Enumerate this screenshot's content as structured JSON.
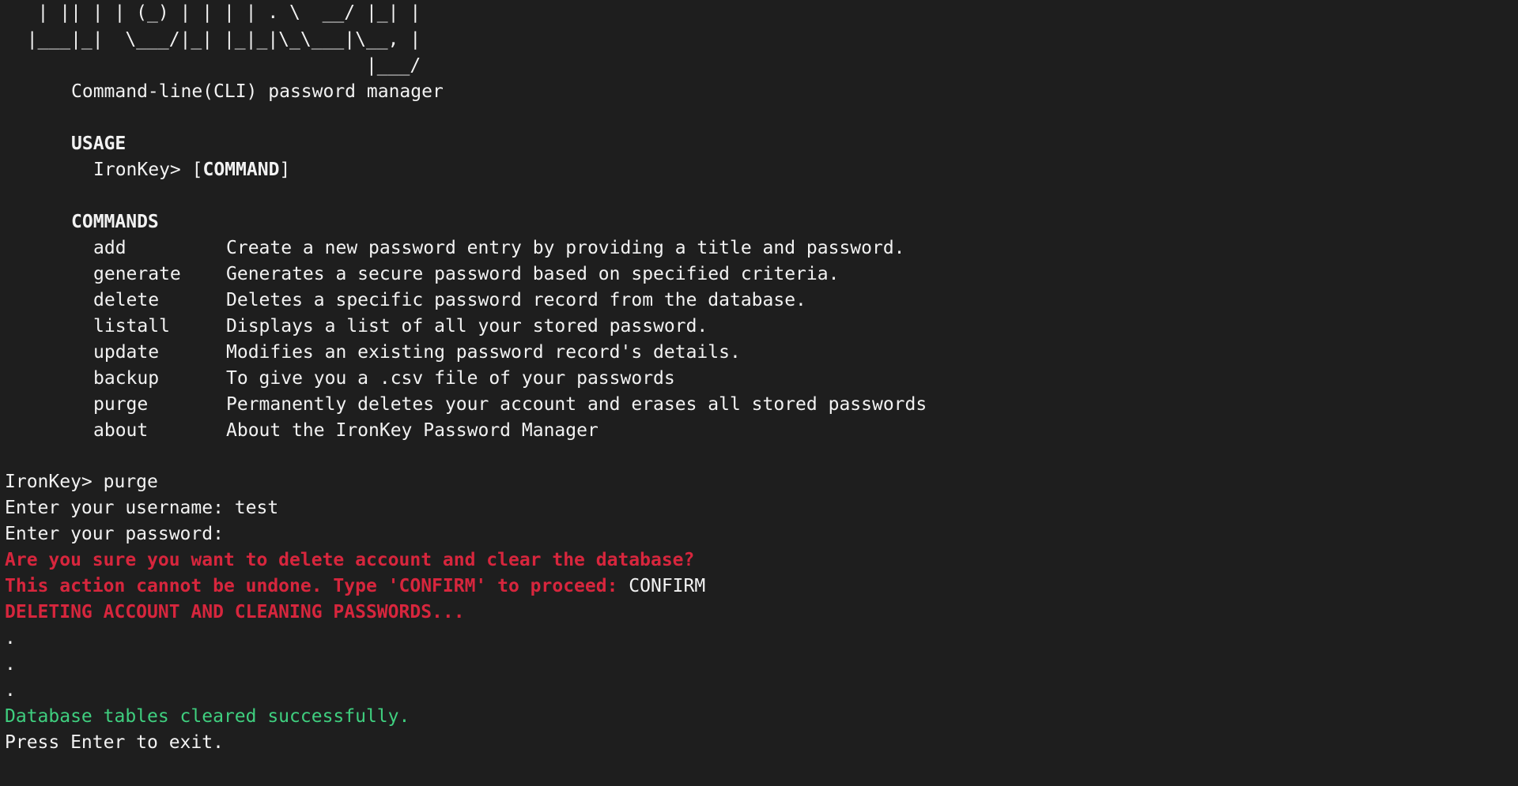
{
  "banner": {
    "ascii_lines": [
      "   | || | | (_) | | | | . \\  __/ |_| |",
      "  |___|_|  \\___/|_| |_|_|\\_\\___|\\__, |",
      "                                 |___/"
    ],
    "tagline": "Command-line(CLI) password manager"
  },
  "usage": {
    "heading": "USAGE",
    "prompt_prefix": "IronKey> [",
    "command_word": "COMMAND",
    "prompt_suffix": "]"
  },
  "commands": {
    "heading": "COMMANDS",
    "items": [
      {
        "name": "add",
        "description": "Create a new password entry by providing a title and password."
      },
      {
        "name": "generate",
        "description": "Generates a secure password based on specified criteria."
      },
      {
        "name": "delete",
        "description": "Deletes a specific password record from the database."
      },
      {
        "name": "listall",
        "description": "Displays a list of all your stored password."
      },
      {
        "name": "update",
        "description": "Modifies an existing password record's details."
      },
      {
        "name": "backup",
        "description": "To give you a .csv file of your passwords"
      },
      {
        "name": "purge",
        "description": "Permanently deletes your account and erases all stored passwords"
      },
      {
        "name": "about",
        "description": "About the IronKey Password Manager"
      }
    ]
  },
  "session": {
    "prompt_line": "IronKey> purge",
    "username_line": "Enter your username: test",
    "password_line": "Enter your password:",
    "warning_line": "Are you sure you want to delete account and clear the database?",
    "confirm_prompt": "This action cannot be undone. Type 'CONFIRM' to proceed: ",
    "confirm_input": "CONFIRM",
    "deleting_line": "DELETING ACCOUNT AND CLEANING PASSWORDS...",
    "dots": [
      ".",
      ".",
      "."
    ],
    "success_line": "Database tables cleared successfully.",
    "exit_line": "Press Enter to exit."
  },
  "colors": {
    "background": "#1e1e1e",
    "text": "#f2f2f2",
    "error": "#d7263d",
    "success": "#3fcf7f"
  }
}
